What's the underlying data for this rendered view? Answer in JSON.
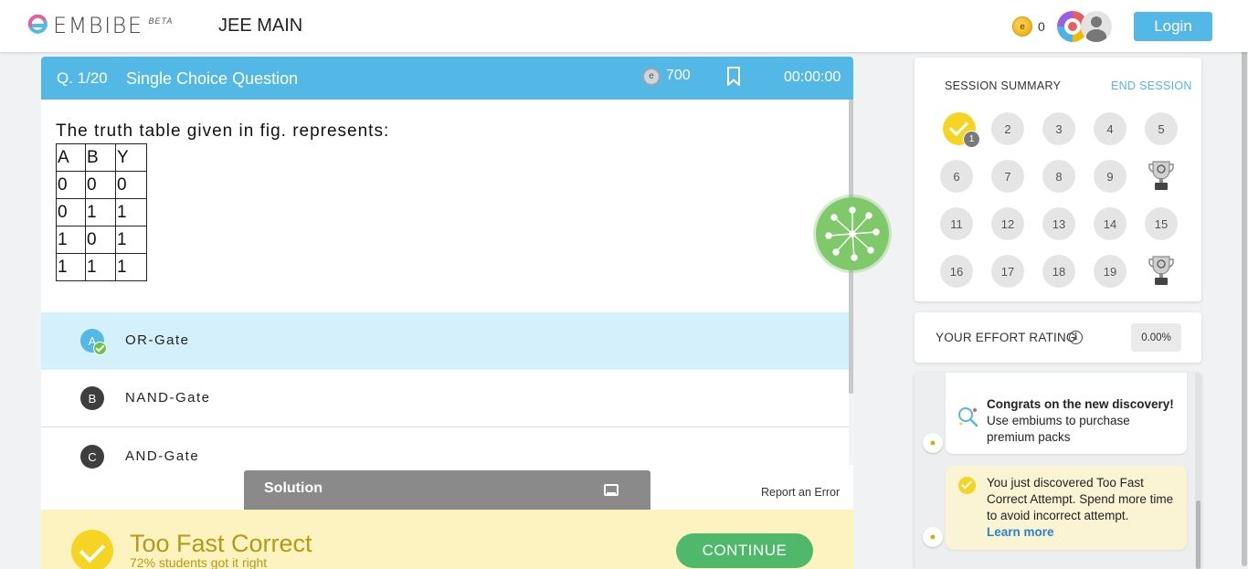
{
  "header": {
    "brand": "EMBIBE",
    "beta": "BETA",
    "exam": "JEE MAIN",
    "coin_count": "0",
    "login_label": "Login"
  },
  "question": {
    "number": "Q. 1/20",
    "type": "Single Choice Question",
    "points": "700",
    "timer": "00:00:00",
    "text": "The truth table given in fig. represents:",
    "table": [
      [
        "A",
        "B",
        "Y"
      ],
      [
        "0",
        "0",
        "0"
      ],
      [
        "0",
        "1",
        "1"
      ],
      [
        "1",
        "0",
        "1"
      ],
      [
        "1",
        "1",
        "1"
      ]
    ],
    "options": [
      {
        "letter": "A",
        "label": "OR-Gate",
        "selected": true
      },
      {
        "letter": "B",
        "label": "NAND-Gate",
        "selected": false
      },
      {
        "letter": "C",
        "label": "AND-Gate",
        "selected": false
      }
    ],
    "solution_label": "Solution",
    "report_error": "Report an Error"
  },
  "result": {
    "title": "Too Fast Correct",
    "subtitle": "72% students got it right",
    "continue_label": "CONTINUE"
  },
  "session": {
    "title": "SESSION SUMMARY",
    "end_label": "END SESSION",
    "done_badge": "1",
    "nodes": [
      "2",
      "3",
      "4",
      "5",
      "6",
      "7",
      "8",
      "9",
      "11",
      "12",
      "13",
      "14",
      "15",
      "16",
      "17",
      "18",
      "19"
    ]
  },
  "effort": {
    "label": "YOUR EFFORT RATING",
    "info": "i",
    "value": "0.00%"
  },
  "feed": {
    "discovery_title": "Congrats on the new discovery!",
    "discovery_text": "Use embiums to purchase premium packs",
    "fast_text": "You just discovered Too Fast Correct Attempt. Spend more time to avoid incorrect attempt.",
    "learn_more": "Learn more"
  },
  "colors": {
    "primary": "#53b8e6",
    "success": "#4fb86a",
    "highlight": "#f6d423",
    "selected_row": "#d3f0fb",
    "result_bg": "#fdf3c0"
  }
}
